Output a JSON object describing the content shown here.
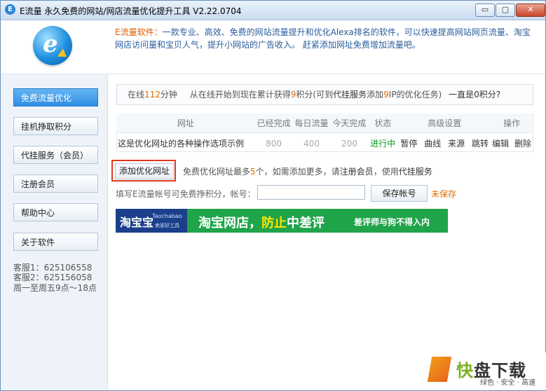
{
  "window": {
    "title": "E流量 永久免费的网站/网店流量优化提升工具 V2.22.0704",
    "app_icon": "E",
    "minimize": "▭",
    "maximize": "▢",
    "close": "✕"
  },
  "header": {
    "logo": "e",
    "brand": "E流量软件：",
    "intro": "一款专业、高效、免费的网站流量提升和优化Alexa排名的软件，可以快速提高网站网页流量、淘宝网店访问量和宝贝人气，提升小网站的广告收入。 赶紧添加网址免费增加流量吧。"
  },
  "sidebar": {
    "items": [
      {
        "label": "免费流量优化",
        "active": true
      },
      {
        "label": "挂机挣取积分",
        "active": false
      },
      {
        "label": "代挂服务（会员）",
        "active": false
      },
      {
        "label": "注册会员",
        "active": false
      },
      {
        "label": "帮助中心",
        "active": false
      },
      {
        "label": "关于软件",
        "active": false
      }
    ],
    "service": [
      "客服1：625106558",
      "客服2：625156058",
      "周一至周五9点～18点"
    ]
  },
  "info": {
    "p1": "在线",
    "online_minutes": "112",
    "p2": "分钟",
    "p3": "从在线开始到现在累计获得",
    "points": "9",
    "p4": "积分(可到",
    "service_link": "代挂服务",
    "p5": "添加",
    "ip_count": "9",
    "p6": "IP的优化任务)",
    "p7": "一直是",
    "p8": "0积分?"
  },
  "table": {
    "headers": [
      "网址",
      "已经完成",
      "每日流量",
      "今天完成",
      "状态",
      "高级设置",
      "操作"
    ],
    "row": {
      "url": "这是优化网址的各种操作选项示例",
      "completed": "800",
      "daily": "400",
      "today": "200",
      "status": "进行中",
      "settings": [
        "暂停",
        "曲线",
        "来源",
        "跳转"
      ],
      "ops": [
        "编辑",
        "删除"
      ]
    }
  },
  "add": {
    "button": "添加优化网址",
    "note1": "免费优化网址最多",
    "max": "5",
    "note2": "个，如需添加更多，请",
    "register_link": "注册会员",
    "note3": "，使用",
    "service_link": "代挂服务"
  },
  "account": {
    "label": "填写E流量帐号可免费挣积分，帐号：",
    "value": "",
    "save_button": "保存帐号",
    "status": "未保存"
  },
  "banner": {
    "logo": "淘宝宝",
    "logo_en": "Taochabao",
    "logo_tag": "卖家好工具",
    "main1": "淘宝网店，",
    "main_highlight": "防止",
    "main2": "中差评",
    "slogan": "差评师与狗不得入内"
  },
  "watermark": {
    "k": "K",
    "title_a": "快",
    "title_b": "盘下载",
    "sub": "绿色 · 安全 · 高速"
  },
  "colors": {
    "accent": "#2f8ee3",
    "orange": "#e46b00",
    "green": "#0b9a21",
    "banner_green": "#1fa44a"
  }
}
